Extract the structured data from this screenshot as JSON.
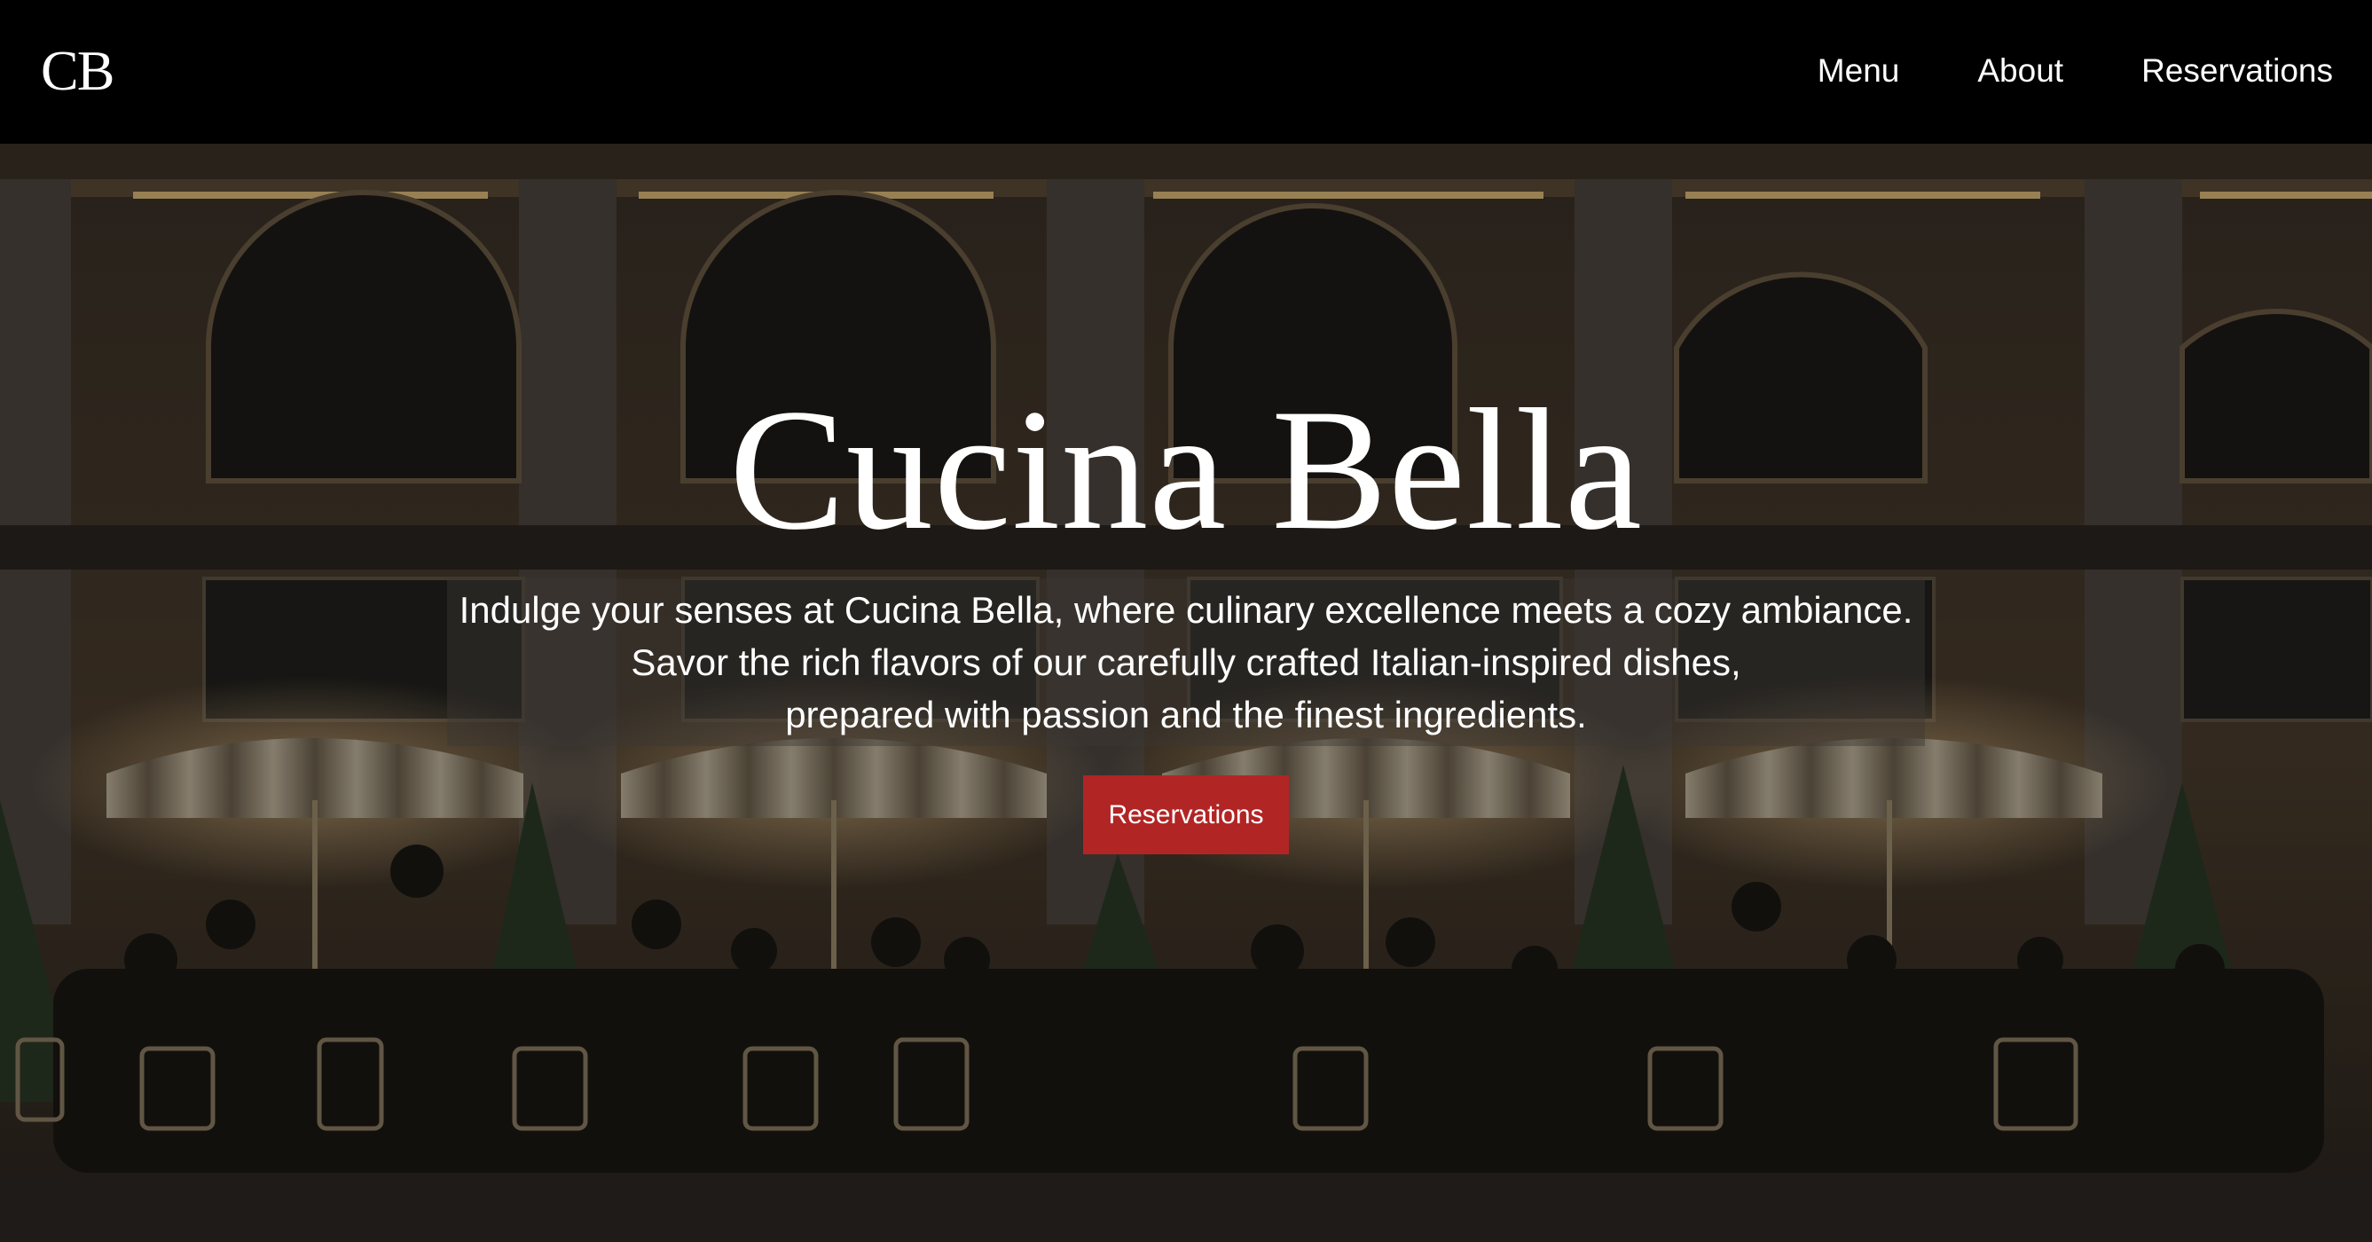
{
  "header": {
    "logo": "CB",
    "nav": [
      {
        "label": "Menu"
      },
      {
        "label": "About"
      },
      {
        "label": "Reservations"
      }
    ]
  },
  "hero": {
    "title": "Cucina Bella",
    "description_lines": [
      "Indulge your senses at Cucina Bella, where culinary excellence meets a cozy ambiance.",
      "Savor the rich flavors of our carefully crafted Italian-inspired dishes,",
      "prepared with passion and the finest ingredients."
    ],
    "cta_label": "Reservations",
    "background_image": "night-cafe-terrace-photo"
  },
  "colors": {
    "header_bg": "#000000",
    "cta_bg": "#b22525",
    "text": "#ffffff"
  }
}
